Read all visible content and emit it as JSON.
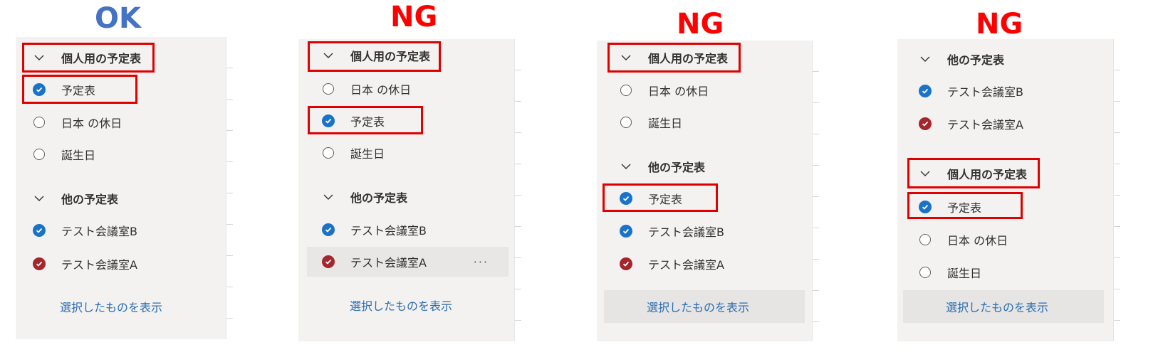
{
  "verdicts": {
    "p1": {
      "text": "OK",
      "color": "#4472c4"
    },
    "p2": {
      "text": "NG",
      "color": "#ff0000"
    },
    "p3": {
      "text": "NG",
      "color": "#ff0000"
    },
    "p4": {
      "text": "NG",
      "color": "#ff0000"
    }
  },
  "colors": {
    "check_blue": "#1a73c9",
    "check_red": "#a4262c",
    "highlight": "#e00000",
    "link": "#2b6cb0"
  },
  "icons": {
    "chevron": "chevron-down-icon",
    "checked": "checkmark-circle-icon",
    "unchecked": "radio-circle-icon",
    "more": "more-options-icon"
  },
  "panel1": {
    "group_personal": "個人用の予定表",
    "item_calendar": "予定表",
    "item_holiday": "日本 の休日",
    "item_birthday": "誕生日",
    "group_other": "他の予定表",
    "item_room_b": "テスト会議室B",
    "item_room_a": "テスト会議室A",
    "show_selected": "選択したものを表示"
  },
  "panel2": {
    "group_personal": "個人用の予定表",
    "item_holiday": "日本 の休日",
    "item_calendar": "予定表",
    "item_birthday": "誕生日",
    "group_other": "他の予定表",
    "item_room_b": "テスト会議室B",
    "item_room_a": "テスト会議室A",
    "more": "···",
    "show_selected": "選択したものを表示"
  },
  "panel3": {
    "group_personal": "個人用の予定表",
    "item_holiday": "日本 の休日",
    "item_birthday": "誕生日",
    "group_other": "他の予定表",
    "item_calendar": "予定表",
    "item_room_b": "テスト会議室B",
    "item_room_a": "テスト会議室A",
    "show_selected": "選択したものを表示"
  },
  "panel4": {
    "group_other": "他の予定表",
    "item_room_b": "テスト会議室B",
    "item_room_a": "テスト会議室A",
    "group_personal": "個人用の予定表",
    "item_calendar": "予定表",
    "item_holiday": "日本 の休日",
    "item_birthday": "誕生日",
    "show_selected": "選択したものを表示"
  }
}
